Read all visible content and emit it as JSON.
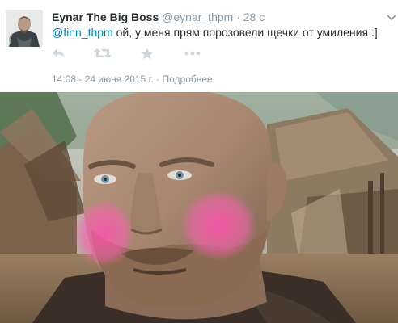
{
  "tweet": {
    "author_name": "Eynar The Big Boss",
    "author_handle": "@eynar_thpm",
    "separator": "·",
    "time_ago": "28 с",
    "mention": "@finn_thpm",
    "text": " ой, у меня прям порозовели щечки от умиления :]",
    "timestamp": "14:08 - 24 июня 2015 г.",
    "meta_separator": " · ",
    "details_link": "Подробнее"
  },
  "icons": {
    "reply": "reply-icon",
    "retweet": "retweet-icon",
    "favorite": "star-icon",
    "more": "more-dots-icon",
    "caret": "chevron-down-icon"
  },
  "colors": {
    "text": "#292f33",
    "muted": "#8899a6",
    "link": "#0084b4",
    "action_icon": "#ccd6dd",
    "blush": "#ff5fb4"
  }
}
